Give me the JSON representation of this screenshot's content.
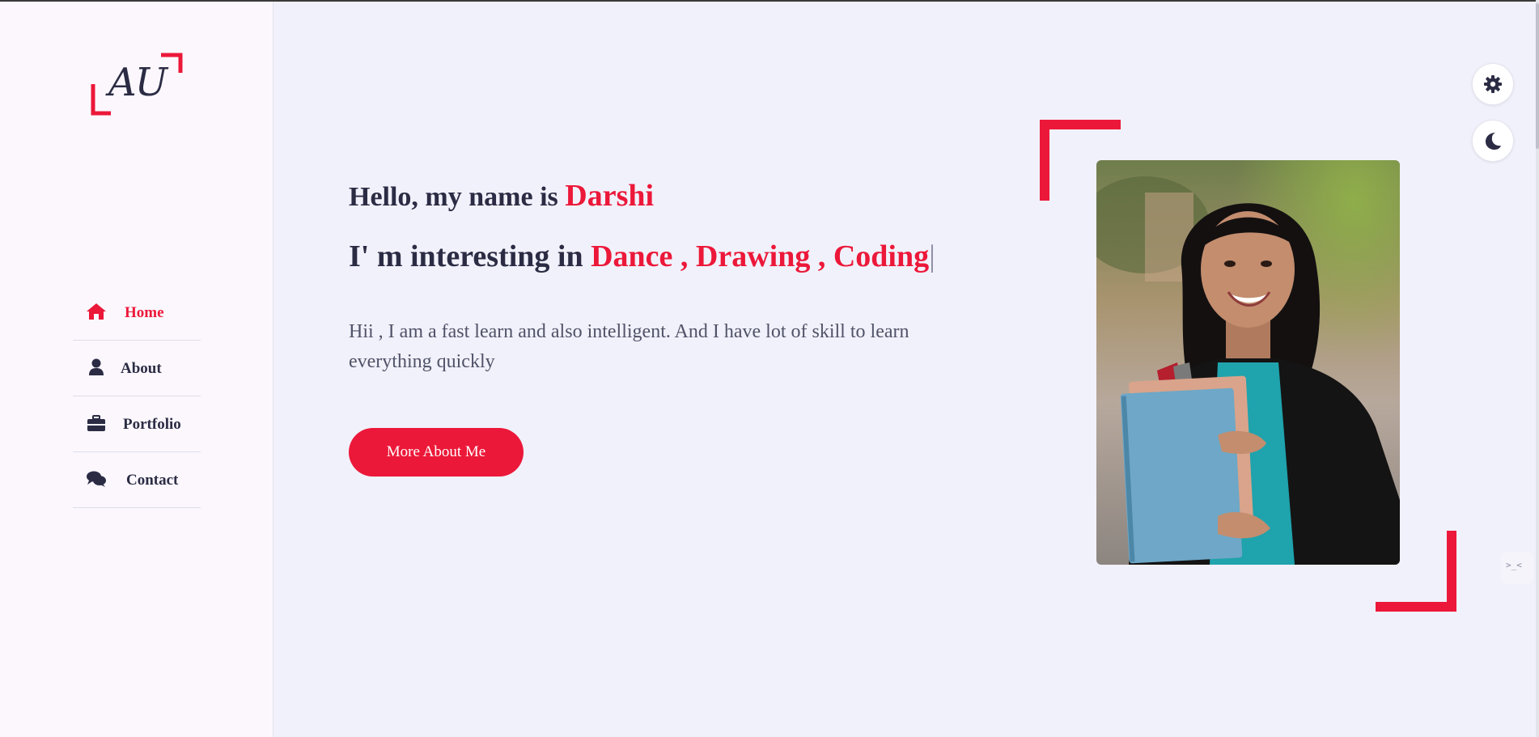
{
  "logo": {
    "letters": "AU"
  },
  "nav": [
    {
      "label": "Home",
      "icon": "home-icon",
      "active": true
    },
    {
      "label": "About",
      "icon": "user-icon",
      "active": false
    },
    {
      "label": "Portfolio",
      "icon": "briefcase-icon",
      "active": false
    },
    {
      "label": "Contact",
      "icon": "comments-icon",
      "active": false
    }
  ],
  "hero": {
    "hello_prefix": "Hello, my name is ",
    "name": "Darshi",
    "interest_prefix": "I' m interesting in ",
    "interests": "Dance , Drawing , Coding",
    "caret": "|",
    "description": "Hii , I am a fast learn and also intelligent. And I have lot of skill to learn everything quickly",
    "button_label": "More About Me"
  },
  "controls": {
    "settings_icon": "gear-icon",
    "theme_icon": "moon-icon",
    "widget_text": ">_<"
  },
  "colors": {
    "accent": "#ec1839",
    "text_dark": "#2b2c44",
    "background": "#f1f1fb",
    "sidebar_bg": "#fbf7fd"
  }
}
